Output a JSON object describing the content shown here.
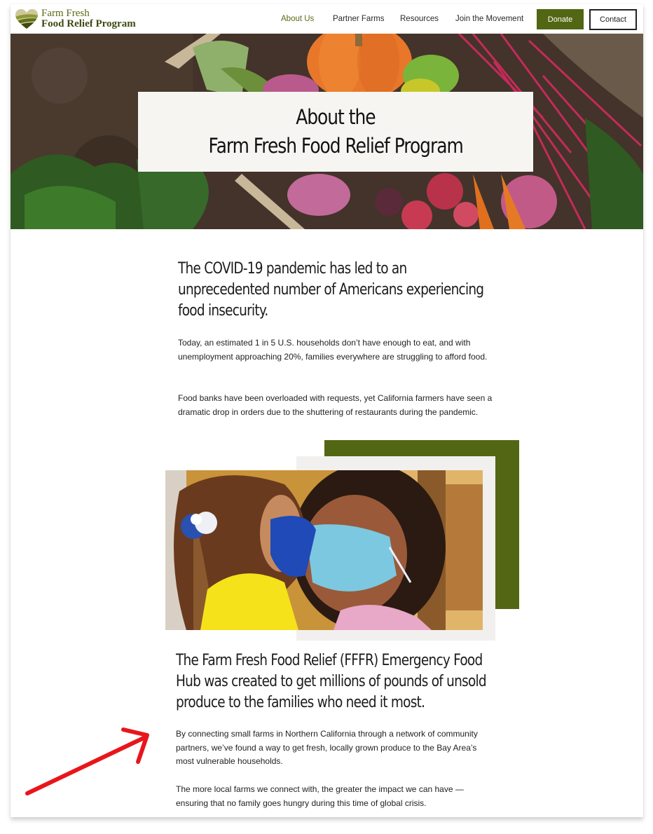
{
  "brand": {
    "line1": "Farm Fresh",
    "line2": "Food Relief Program",
    "logo_icon": "heart-field-icon",
    "color": "#536613"
  },
  "nav": {
    "items": [
      {
        "label": "About Us",
        "active": true
      },
      {
        "label": "Partner Farms",
        "active": false
      },
      {
        "label": "Resources",
        "active": false
      },
      {
        "label": "Join the Movement",
        "active": false
      }
    ],
    "donate_label": "Donate",
    "contact_label": "Contact"
  },
  "hero": {
    "title_line1": "About the",
    "title_line2": "Farm Fresh Food Relief Program"
  },
  "section1": {
    "headline": "The COVID-19 pandemic has led to an unprecedented number of Americans experiencing food insecurity.",
    "paragraphs": [
      "Today, an estimated 1 in 5 U.S. households don’t have enough to eat, and with unemployment approaching 20%, families everywhere are struggling to afford food.",
      "Food banks have been overloaded with requests, yet  California farmers have seen a dramatic drop in orders due to the shuttering of restaurants during the pandemic."
    ]
  },
  "section2": {
    "headline": "The Farm Fresh Food Relief (FFFR) Emergency Food Hub was created to get millions of pounds of unsold produce to the families who need it most.",
    "paragraphs": [
      "By connecting small farms in Northern California through a network of community partners, we’ve found a way to get fresh, locally grown produce to the Bay Area’s most vulnerable households.",
      "The more local farms we connect with, the greater the impact we can have — ensuring that no family goes hungry during this time of global crisis."
    ]
  },
  "colors": {
    "accent_green": "#536613",
    "annotation_arrow": "#e8161b"
  }
}
